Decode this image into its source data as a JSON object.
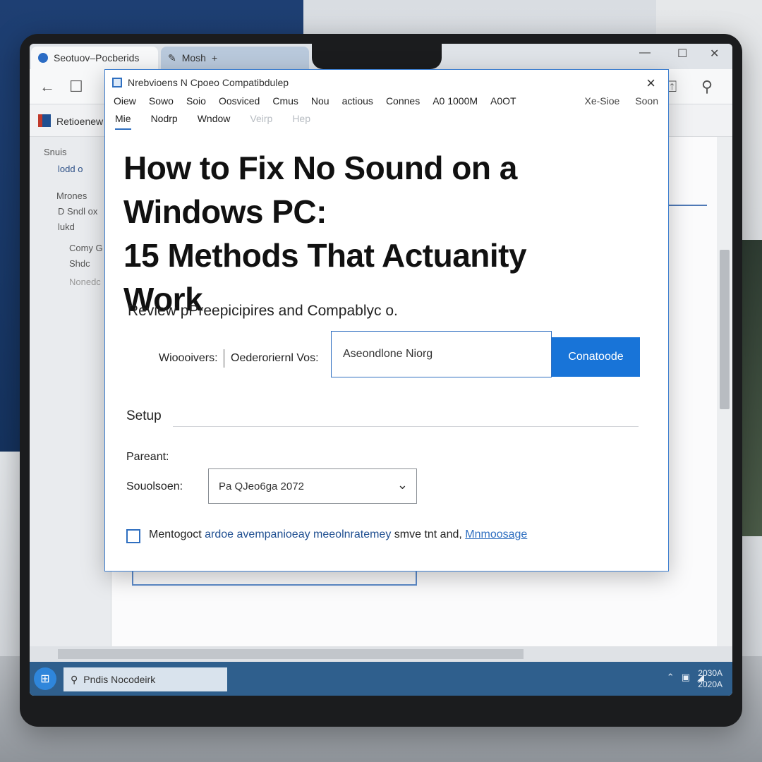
{
  "browser": {
    "tabs": [
      {
        "label": "Seotuov–Pocberids"
      },
      {
        "label": "Mosh"
      }
    ],
    "window_controls": {
      "minimize": "—",
      "maximize": "☐",
      "close": "✕"
    },
    "app_name": "Retioenew"
  },
  "sidebar": {
    "items": [
      {
        "label": "Snuis"
      },
      {
        "label": "lodd o"
      },
      {
        "label": "Mrones"
      },
      {
        "label": "D Sndl ox"
      },
      {
        "label": "lukd"
      },
      {
        "label": "Comy G"
      },
      {
        "label": "Shdc"
      },
      {
        "label": "Nonedc"
      }
    ]
  },
  "dialog": {
    "title": "Nrebvioens N Cpoeo Compatibdulep",
    "menu_primary": [
      "Oiew",
      "Sowo",
      "Soio",
      "Oosviced",
      "Cmus",
      "Nou",
      "actious",
      "Connes",
      "A0 1000M",
      "A0OT"
    ],
    "menu_right": [
      "Xe-Sioe",
      "Soon"
    ],
    "menu_secondary": [
      {
        "label": "Mie",
        "state": "active"
      },
      {
        "label": "Nodrp",
        "state": "normal"
      },
      {
        "label": "Wndow",
        "state": "normal"
      },
      {
        "label": "Veirp",
        "state": "disabled"
      },
      {
        "label": "Hep",
        "state": "disabled"
      }
    ],
    "headline_line1": "How to Fix No Sound on a Windows PC:",
    "headline_line2": "15 Methods That Actuanity",
    "headline_line3": "Work",
    "subhead": "Review pPreepicipires and Compablyc o.",
    "row_label_a": "Wioooivers:",
    "row_label_b": "Oederoriernl Vos:",
    "input_value": "Aseondlone Niorg",
    "primary_button": "Conatoode",
    "section_title": "Setup",
    "field_label": "Pareant:",
    "select_label": "Souolsoen:",
    "select_value": "Pa QJeo6ga 2072",
    "checkbox_checked": false,
    "checkbox_text_a": "Mentogoct ",
    "checkbox_text_b": "ardoe avempanioeay meeolnratemey",
    "checkbox_text_c": "smve tnt and,",
    "checkbox_link": "Mnmoosage"
  },
  "taskbar": {
    "search_text": "Pndis Nocodeirk",
    "clock_line1": "2030A",
    "clock_line2": "2020A"
  },
  "colors": {
    "accent": "#1874d8",
    "dialog_border": "#3f7fcf",
    "taskbar": "#2f5f8d"
  }
}
